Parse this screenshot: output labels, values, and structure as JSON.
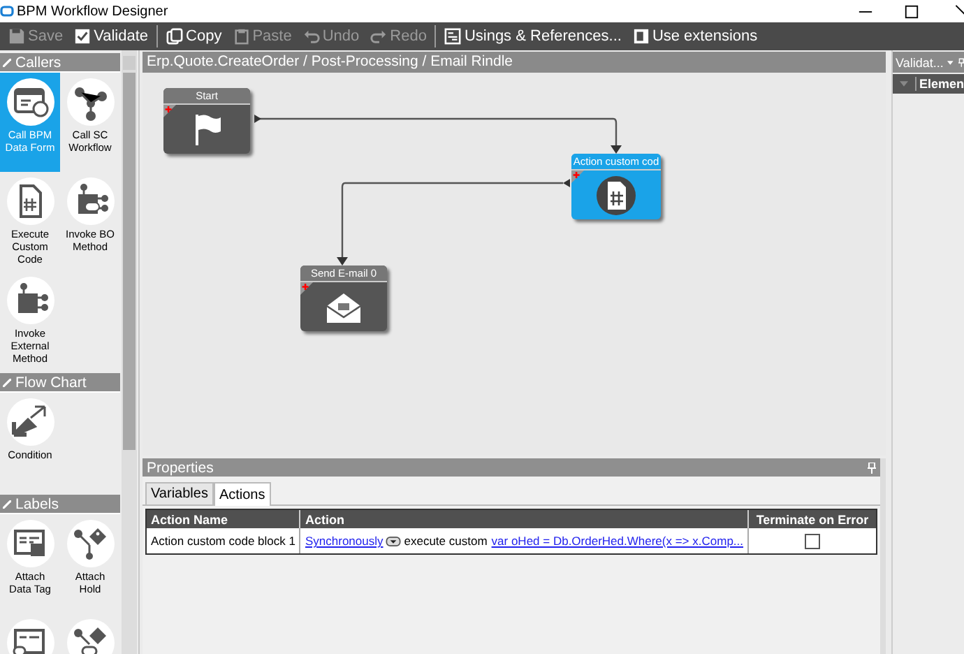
{
  "window": {
    "title": "BPM Workflow Designer"
  },
  "toolbar": [
    [
      {
        "label": "Save",
        "kind": "save",
        "disabled": true
      },
      {
        "label": "Validate",
        "kind": "validate",
        "disabled": false
      }
    ],
    [
      {
        "label": "Copy",
        "kind": "copy",
        "disabled": false
      },
      {
        "label": "Paste",
        "kind": "paste",
        "disabled": true
      },
      {
        "label": "Undo",
        "kind": "undo",
        "disabled": true
      },
      {
        "label": "Redo",
        "kind": "redo",
        "disabled": true
      }
    ],
    [
      {
        "label": "Usings & References...",
        "kind": "usings",
        "disabled": false
      },
      {
        "label": "Use extensions",
        "kind": "extensions",
        "disabled": false
      }
    ]
  ],
  "palette": [
    {
      "title": "Callers",
      "items": [
        {
          "kind": "form",
          "label": "Call BPM Data Form",
          "selected": true
        },
        {
          "kind": "workflow",
          "label": "Call SC Workflow",
          "selected": false
        },
        {
          "kind": "code",
          "label": "Execute Custom Code",
          "selected": false
        },
        {
          "kind": "bo",
          "label": "Invoke BO Method",
          "selected": false
        },
        {
          "kind": "external",
          "label": "Invoke External Method",
          "selected": false
        }
      ]
    },
    {
      "title": "Flow Chart",
      "items": [
        {
          "kind": "condition",
          "label": "Condition",
          "selected": false
        }
      ]
    },
    {
      "title": "Labels",
      "items": [
        {
          "kind": "datatag",
          "label": "Attach Data Tag",
          "selected": false
        },
        {
          "kind": "hold",
          "label": "Attach Hold",
          "selected": false
        },
        {
          "kind": "datatag2",
          "selected": false
        },
        {
          "kind": "hold2",
          "selected": false
        }
      ]
    }
  ],
  "canvas": {
    "breadcrumb": "Erp.Quote.CreateOrder / Post-Processing / Email Rindle",
    "nodes": [
      {
        "kind": "start",
        "title": "Start",
        "selected": false
      },
      {
        "kind": "code",
        "title": "Action custom cod",
        "selected": true
      },
      {
        "kind": "email",
        "title": "Send E-mail 0",
        "selected": false
      }
    ]
  },
  "properties": {
    "title": "Properties",
    "tabs": [
      {
        "label": "Variables",
        "selected": false
      },
      {
        "label": "Actions",
        "selected": true
      }
    ],
    "columns": [
      "Action Name",
      "Action",
      "Terminate on Error"
    ],
    "rows": [
      {
        "name": "Action custom code block 1",
        "mode": "Synchronously",
        "text": "execute custom",
        "code": "var oHed = Db.OrderHed.Where(x => x.Comp...",
        "terminate_on_error": false
      }
    ]
  },
  "validation": {
    "title": "Validat...",
    "column": "Elemen"
  }
}
